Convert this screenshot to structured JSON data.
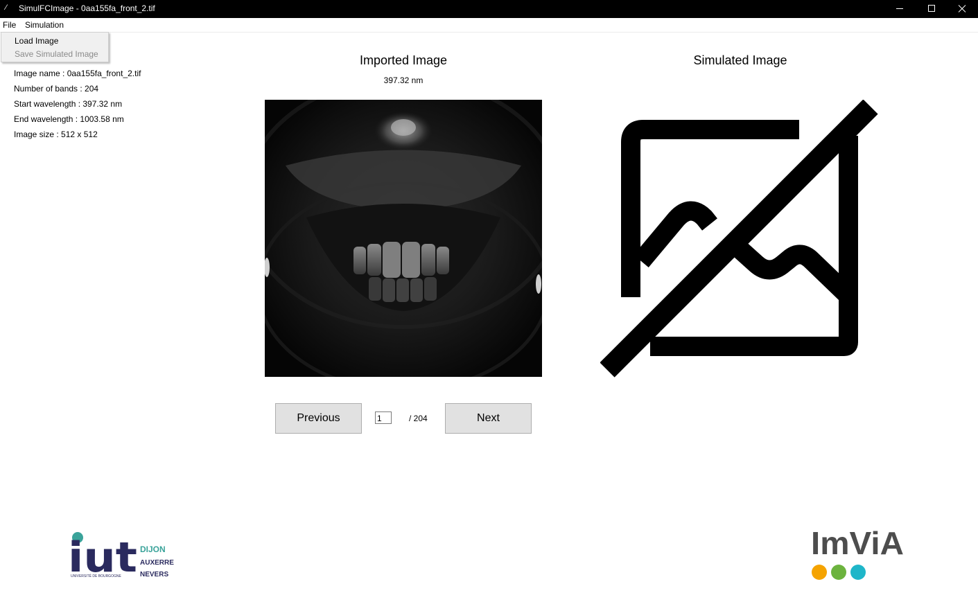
{
  "window": {
    "title": "SimulFCImage - 0aa155fa_front_2.tif"
  },
  "menubar": {
    "file": "File",
    "simulation": "Simulation"
  },
  "file_menu": {
    "load_image": "Load Image",
    "save_simulated_image": "Save Simulated Image",
    "save_enabled": false
  },
  "info": {
    "image_name": "Image name : 0aa155fa_front_2.tif",
    "number_of_bands": "Number of bands : 204",
    "start_wavelength": "Start wavelength : 397.32 nm",
    "end_wavelength": "End wavelength : 1003.58 nm",
    "image_size": "Image size : 512 x 512"
  },
  "imported": {
    "title": "Imported Image",
    "wavelength": "397.32 nm"
  },
  "simulated": {
    "title": "Simulated Image",
    "placeholder_icon": "image-off-icon"
  },
  "navigation": {
    "previous_label": "Previous",
    "next_label": "Next",
    "current_band": "1",
    "total_bands": "/ 204"
  },
  "logos": {
    "iut": {
      "main": "iut",
      "lines": [
        "DIJON",
        "AUXERRE",
        "NEVERS"
      ],
      "subline": "UNIVERSITÉ DE BOURGOGNE",
      "color": "#2a2a5e",
      "accent": "#3aa39a"
    },
    "imvia": {
      "text": "ImViA",
      "color": "#4d4d4d",
      "dots": [
        "#f5a300",
        "#6cb33e",
        "#1fb6c9"
      ]
    }
  }
}
